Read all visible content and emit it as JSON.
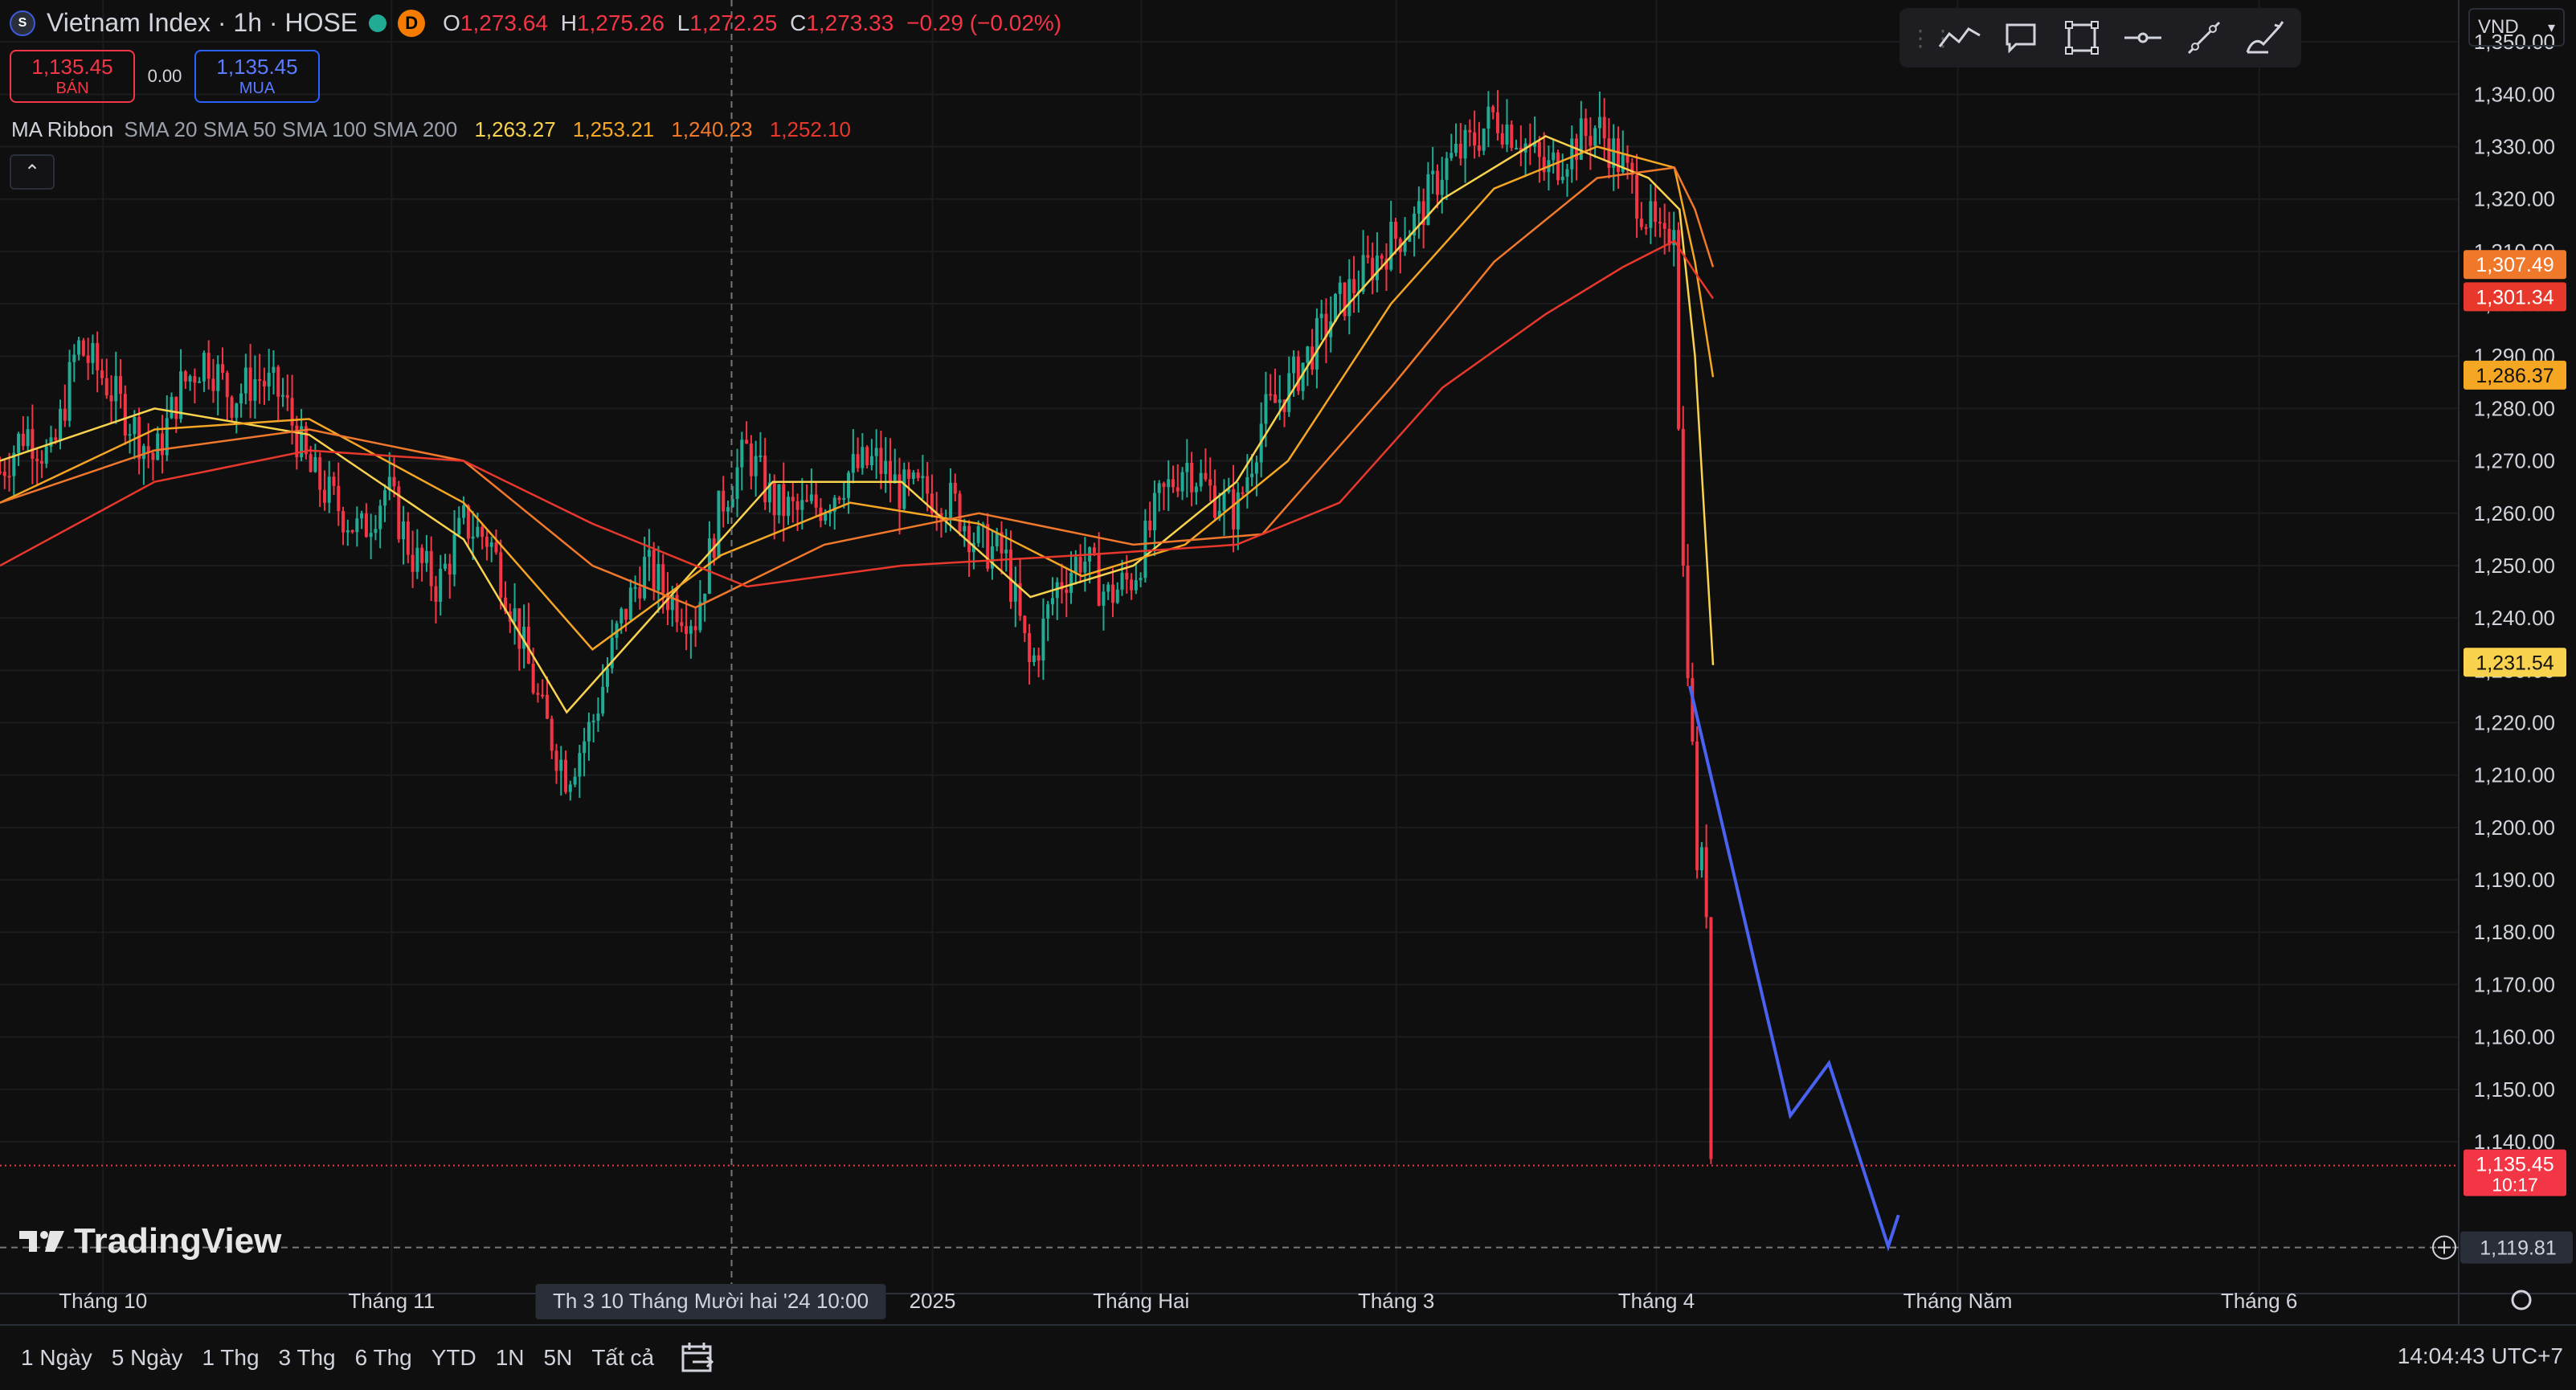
{
  "legend": {
    "title": "Vietnam Index · 1h · HOSE",
    "badge": "D",
    "open_label": "O",
    "open": "1,273.64",
    "high_label": "H",
    "high": "1,275.26",
    "low_label": "L",
    "low": "1,272.25",
    "close_label": "C",
    "close": "1,273.33",
    "change": "−0.29 (−0.02%)"
  },
  "trade": {
    "sell_value": "1,135.45",
    "sell_label": "BÁN",
    "spread": "0.00",
    "buy_value": "1,135.45",
    "buy_label": "MUA"
  },
  "ma_ribbon": {
    "name": "MA Ribbon",
    "params": "SMA 20 SMA 50 SMA 100 SMA 200",
    "values": [
      "1,263.27",
      "1,253.21",
      "1,240.23",
      "1,252.10"
    ],
    "colors": [
      "#f9d34d",
      "#f5a623",
      "#f0782b",
      "#e8382c"
    ]
  },
  "currency": "VND",
  "crosshair_label": "Th 3 10 Tháng Mười hai '24   10:00",
  "clock": "14:04:43 UTC+7",
  "range_buttons": [
    "1 Ngày",
    "5 Ngày",
    "1 Thg",
    "3 Thg",
    "6 Thg",
    "YTD",
    "1N",
    "5N",
    "Tất cả"
  ],
  "logo_text": "TradingView",
  "icons": {
    "toolbar": [
      "trend-line-icon",
      "comment-icon",
      "rectangle-icon",
      "horizontal-ray-icon",
      "ray-icon",
      "brush-icon"
    ]
  },
  "chart_data": {
    "type": "line",
    "description_of_series": "candlestick",
    "y_axis": {
      "ylim": [
        1111,
        1358
      ],
      "ticks": [
        1350,
        1340,
        1330,
        1320,
        1310,
        1300,
        1290,
        1280,
        1270,
        1260,
        1250,
        1240,
        1230,
        1220,
        1210,
        1200,
        1190,
        1180,
        1170,
        1160,
        1150,
        1140
      ],
      "tick_labels": [
        "1,350.00",
        "1,340.00",
        "1,330.00",
        "1,320.00",
        "1,310.00",
        "1,300.00",
        "1,290.00",
        "1,280.00",
        "1,270.00",
        "1,260.00",
        "1,250.00",
        "1,240.00",
        "1,230.00",
        "1,220.00",
        "1,210.00",
        "1,200.00",
        "1,190.00",
        "1,180.00",
        "1,170.00",
        "1,160.00",
        "1,150.00",
        "1,140.00"
      ]
    },
    "x_axis": {
      "labels": [
        "Tháng 10",
        "Tháng 11",
        "2025",
        "Tháng Hai",
        "Tháng 3",
        "Tháng 4",
        "Tháng Năm",
        "Tháng 6"
      ],
      "label_positions": [
        0.04,
        0.152,
        0.362,
        0.443,
        0.542,
        0.643,
        0.76,
        0.877
      ]
    },
    "price_badges": [
      {
        "value": 1307.49,
        "label": "1,307.49",
        "color": "#f0782b"
      },
      {
        "value": 1301.34,
        "label": "1,301.34",
        "color": "#e8382c"
      },
      {
        "value": 1286.37,
        "label": "1,286.37",
        "color": "#f5a623"
      },
      {
        "value": 1231.54,
        "label": "1,231.54",
        "color": "#f9d34d"
      },
      {
        "value": 1135.45,
        "label": "1,135.45",
        "sub": "10:17",
        "color": "#f23645"
      }
    ],
    "crosshair_price": {
      "value": 1119.81,
      "label": "1,119.81"
    },
    "last_price": 1135.45,
    "price_path": [
      [
        0.0,
        1268
      ],
      [
        0.01,
        1276
      ],
      [
        0.02,
        1270
      ],
      [
        0.03,
        1292
      ],
      [
        0.04,
        1286
      ],
      [
        0.05,
        1278
      ],
      [
        0.06,
        1270
      ],
      [
        0.07,
        1284
      ],
      [
        0.08,
        1290
      ],
      [
        0.09,
        1282
      ],
      [
        0.1,
        1286
      ],
      [
        0.11,
        1282
      ],
      [
        0.12,
        1268
      ],
      [
        0.13,
        1262
      ],
      [
        0.14,
        1256
      ],
      [
        0.15,
        1265
      ],
      [
        0.16,
        1252
      ],
      [
        0.17,
        1246
      ],
      [
        0.18,
        1258
      ],
      [
        0.19,
        1255
      ],
      [
        0.2,
        1240
      ],
      [
        0.21,
        1222
      ],
      [
        0.22,
        1210
      ],
      [
        0.23,
        1220
      ],
      [
        0.24,
        1238
      ],
      [
        0.25,
        1250
      ],
      [
        0.26,
        1244
      ],
      [
        0.27,
        1240
      ],
      [
        0.28,
        1262
      ],
      [
        0.29,
        1272
      ],
      [
        0.3,
        1262
      ],
      [
        0.31,
        1260
      ],
      [
        0.32,
        1262
      ],
      [
        0.33,
        1268
      ],
      [
        0.34,
        1270
      ],
      [
        0.35,
        1264
      ],
      [
        0.36,
        1264
      ],
      [
        0.37,
        1262
      ],
      [
        0.38,
        1254
      ],
      [
        0.39,
        1252
      ],
      [
        0.4,
        1230
      ],
      [
        0.41,
        1246
      ],
      [
        0.42,
        1252
      ],
      [
        0.43,
        1244
      ],
      [
        0.44,
        1248
      ],
      [
        0.45,
        1262
      ],
      [
        0.46,
        1270
      ],
      [
        0.47,
        1264
      ],
      [
        0.48,
        1260
      ],
      [
        0.49,
        1278
      ],
      [
        0.5,
        1284
      ],
      [
        0.51,
        1292
      ],
      [
        0.52,
        1300
      ],
      [
        0.53,
        1306
      ],
      [
        0.54,
        1312
      ],
      [
        0.55,
        1316
      ],
      [
        0.56,
        1326
      ],
      [
        0.57,
        1330
      ],
      [
        0.58,
        1336
      ],
      [
        0.59,
        1332
      ],
      [
        0.6,
        1325
      ],
      [
        0.61,
        1330
      ],
      [
        0.62,
        1334
      ],
      [
        0.63,
        1326
      ],
      [
        0.64,
        1316
      ],
      [
        0.646,
        1310
      ],
      [
        0.65,
        1318
      ],
      [
        0.652,
        1270
      ],
      [
        0.654,
        1240
      ],
      [
        0.656,
        1228
      ],
      [
        0.658,
        1200
      ],
      [
        0.66,
        1185
      ],
      [
        0.662,
        1210
      ],
      [
        0.663,
        1150
      ],
      [
        0.664,
        1138
      ],
      [
        0.666,
        1135
      ]
    ],
    "ma_paths": [
      {
        "name": "SMA 20",
        "color": "#f9d34d",
        "points": [
          [
            0.0,
            1270
          ],
          [
            0.06,
            1280
          ],
          [
            0.12,
            1275
          ],
          [
            0.18,
            1255
          ],
          [
            0.22,
            1222
          ],
          [
            0.26,
            1244
          ],
          [
            0.3,
            1266
          ],
          [
            0.35,
            1266
          ],
          [
            0.4,
            1244
          ],
          [
            0.44,
            1250
          ],
          [
            0.48,
            1266
          ],
          [
            0.52,
            1298
          ],
          [
            0.56,
            1320
          ],
          [
            0.6,
            1332
          ],
          [
            0.64,
            1324
          ],
          [
            0.652,
            1318
          ],
          [
            0.658,
            1290
          ],
          [
            0.665,
            1231
          ]
        ]
      },
      {
        "name": "SMA 50",
        "color": "#f5a623",
        "points": [
          [
            0.0,
            1262
          ],
          [
            0.06,
            1276
          ],
          [
            0.12,
            1278
          ],
          [
            0.18,
            1262
          ],
          [
            0.23,
            1234
          ],
          [
            0.28,
            1252
          ],
          [
            0.33,
            1262
          ],
          [
            0.38,
            1258
          ],
          [
            0.42,
            1248
          ],
          [
            0.46,
            1254
          ],
          [
            0.5,
            1270
          ],
          [
            0.54,
            1300
          ],
          [
            0.58,
            1322
          ],
          [
            0.62,
            1330
          ],
          [
            0.65,
            1326
          ],
          [
            0.658,
            1308
          ],
          [
            0.665,
            1286
          ]
        ]
      },
      {
        "name": "SMA 100",
        "color": "#f0782b",
        "points": [
          [
            0.0,
            1262
          ],
          [
            0.06,
            1272
          ],
          [
            0.12,
            1276
          ],
          [
            0.18,
            1270
          ],
          [
            0.23,
            1250
          ],
          [
            0.27,
            1242
          ],
          [
            0.32,
            1254
          ],
          [
            0.38,
            1260
          ],
          [
            0.44,
            1254
          ],
          [
            0.49,
            1256
          ],
          [
            0.54,
            1284
          ],
          [
            0.58,
            1308
          ],
          [
            0.62,
            1324
          ],
          [
            0.65,
            1326
          ],
          [
            0.658,
            1318
          ],
          [
            0.665,
            1307
          ]
        ]
      },
      {
        "name": "SMA 200",
        "color": "#e8382c",
        "points": [
          [
            0.0,
            1250
          ],
          [
            0.06,
            1266
          ],
          [
            0.12,
            1272
          ],
          [
            0.18,
            1270
          ],
          [
            0.23,
            1258
          ],
          [
            0.29,
            1246
          ],
          [
            0.35,
            1250
          ],
          [
            0.42,
            1252
          ],
          [
            0.48,
            1254
          ],
          [
            0.52,
            1262
          ],
          [
            0.56,
            1284
          ],
          [
            0.6,
            1298
          ],
          [
            0.63,
            1307
          ],
          [
            0.65,
            1312
          ],
          [
            0.658,
            1306
          ],
          [
            0.665,
            1301
          ]
        ]
      }
    ],
    "projection_path": [
      [
        0.656,
        1227
      ],
      [
        0.695,
        1145
      ],
      [
        0.71,
        1155
      ],
      [
        0.733,
        1120
      ],
      [
        0.737,
        1126
      ]
    ],
    "crosshair_x": 0.284
  }
}
